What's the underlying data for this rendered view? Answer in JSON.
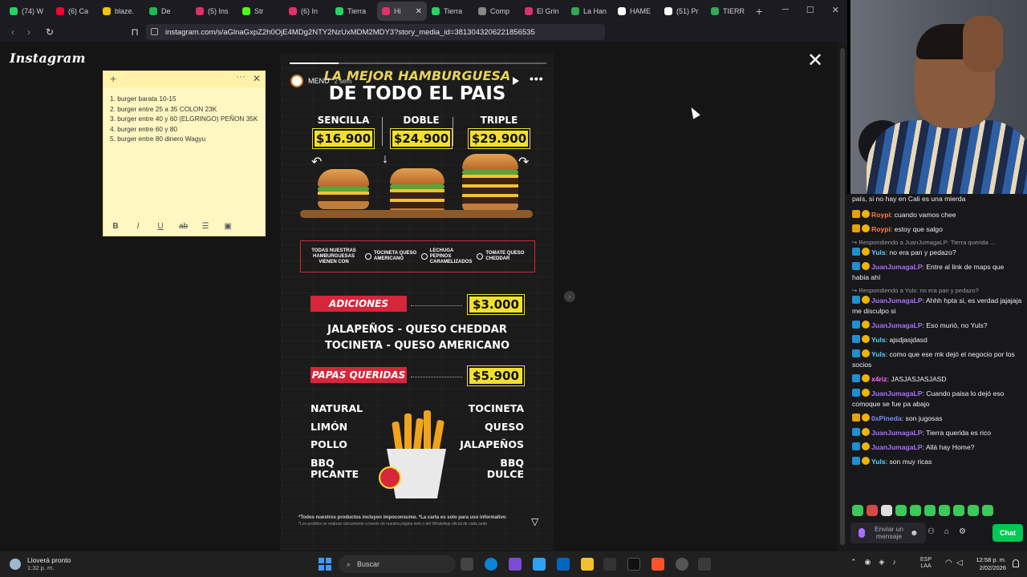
{
  "browser": {
    "tabs": [
      {
        "label": "(74) W",
        "color": "#25d366"
      },
      {
        "label": "(6) Ca",
        "color": "#ff0033"
      },
      {
        "label": "blaze.",
        "color": "#f5c400"
      },
      {
        "label": "De",
        "color": "#1db954"
      },
      {
        "label": "(5) Ins",
        "color": "#e1306c"
      },
      {
        "label": "Str",
        "color": "#53fc18"
      },
      {
        "label": "(6) In",
        "color": "#e1306c"
      },
      {
        "label": "Tierra",
        "color": "#25d366"
      },
      {
        "label": "Hi",
        "color": "#e1306c",
        "active": true
      },
      {
        "label": "Tierra",
        "color": "#25d366"
      },
      {
        "label": "Comp",
        "color": "#888888"
      },
      {
        "label": "El Grin",
        "color": "#d6336c"
      },
      {
        "label": "La Han",
        "color": "#34a853"
      },
      {
        "label": "HAME",
        "color": "#ffffff"
      },
      {
        "label": "(51) Pr",
        "color": "#ffffff"
      },
      {
        "label": "TIERR",
        "color": "#34a853"
      }
    ],
    "url": "instagram.com/s/aGlnaGxpZ2h0OjE4MDg2NTY2NzUxMDM2MDY3?story_media_id=3813043206221856535"
  },
  "instagram": {
    "logo": "Instagram",
    "close": "✕"
  },
  "sticky_note": {
    "items": [
      "1. burger barata 10-15",
      "2. burger entre 25 a 35 COLON 23K",
      "3. burger entre 40 y 60 (ELGRINGO) PEÑON 35K",
      "4. burger entre 60 y 80",
      "5. burger entre 80 dinero Wagyu"
    ],
    "tools": [
      "B",
      "I",
      "U",
      "ab",
      "☰",
      "▣"
    ]
  },
  "story": {
    "account": "MENÚ",
    "time": "2 sem",
    "progress": 0.19,
    "title_top": "LA MEJOR HAMBURGUESA",
    "title_main": "DE TODO EL PAIS",
    "sizes": [
      {
        "name": "SENCILLA",
        "price": "$16.900"
      },
      {
        "name": "DOBLE",
        "price": "$24.900"
      },
      {
        "name": "TRIPLE",
        "price": "$29.900"
      }
    ],
    "includes_head": "TODAS NUESTRAS HAMBURGUESAS VIENEN CON",
    "includes": [
      "TOCINETA QUESO AMERICANO",
      "LECHUGA PEPINOS CARAMELIZADOS",
      "TOMATE QUESO CHEDDAR"
    ],
    "adiciones_label": "ADICIONES",
    "adiciones_price": "$3.000",
    "adiciones_line1": "JALAPEÑOS - QUESO CHEDDAR",
    "adiciones_line2": "TOCINETA - QUESO AMERICANO",
    "papas_label": "PAPAS QUERIDAS",
    "papas_price": "$5.900",
    "flavors_left": [
      "NATURAL",
      "LIMÓN",
      "POLLO",
      "BBQ PICANTE"
    ],
    "flavors_right": [
      "TOCINETA",
      "QUESO",
      "JALAPEÑOS",
      "BBQ DULCE"
    ],
    "footer1": "*Todos nuestros productos incluyen impoconsumo. *La carta es solo para uso informativo",
    "footer2": "*Los pedidos se realizan únicamente a través de nuestra página web o del WhatsApp oficial de cada sede"
  },
  "chat": {
    "top_text": "país, si no hay en Cali es una mierda",
    "messages": [
      {
        "user": "Roypi",
        "color": "#ff7f3f",
        "text": "cuando vamos chee"
      },
      {
        "user": "Roypi",
        "color": "#ff7f3f",
        "text": "estoy que salgo"
      },
      {
        "reply": "Respondiendo a JuanJumagaLP: Tierra querida ..."
      },
      {
        "user": "Yuls",
        "color": "#5bd1ff",
        "text": "no era pan y pedazo?"
      },
      {
        "user": "JuanJumagaLP",
        "color": "#a970ff",
        "text": "Entre al link de maps que habia ahí"
      },
      {
        "reply": "Respondiendo a Yuls: no era pan y pedazo?"
      },
      {
        "user": "JuanJumagaLP",
        "color": "#a970ff",
        "text": "Ahhh hpta si, es verdad jajajaja me disculpo si"
      },
      {
        "user": "JuanJumagaLP",
        "color": "#a970ff",
        "text": "Eso murió, no Yuls?"
      },
      {
        "user": "Yuls",
        "color": "#5bd1ff",
        "text": "ajsdjasjdasd"
      },
      {
        "user": "Yuls",
        "color": "#5bd1ff",
        "text": "como que ese mk dejó el negocio por los socios"
      },
      {
        "user": "x4riz",
        "color": "#ff6bff",
        "text": "JASJASJASJASD"
      },
      {
        "user": "JuanJumagaLP",
        "color": "#a970ff",
        "text": "Cuando paisa lo dejó eso comoque se fue pa abajo"
      },
      {
        "user": "0xPineda",
        "color": "#7a8cff",
        "text": "son jugosas"
      },
      {
        "user": "JuanJumagaLP",
        "color": "#a970ff",
        "text": "Tierra querida es rico"
      },
      {
        "user": "JuanJumagaLP",
        "color": "#a970ff",
        "text": "Allá hay Home?"
      },
      {
        "user": "Yuls",
        "color": "#5bd1ff",
        "text": "son muy ricas"
      }
    ],
    "input_placeholder": "Enviar un mensaje",
    "chat_button": "Chat"
  },
  "taskbar": {
    "weather_title": "Lloverá pronto",
    "weather_time": "1:32 p. m.",
    "search": "Buscar",
    "lang1": "ESP",
    "lang2": "LAA",
    "time": "12:58 p. m.",
    "date": "2/02/2026"
  }
}
